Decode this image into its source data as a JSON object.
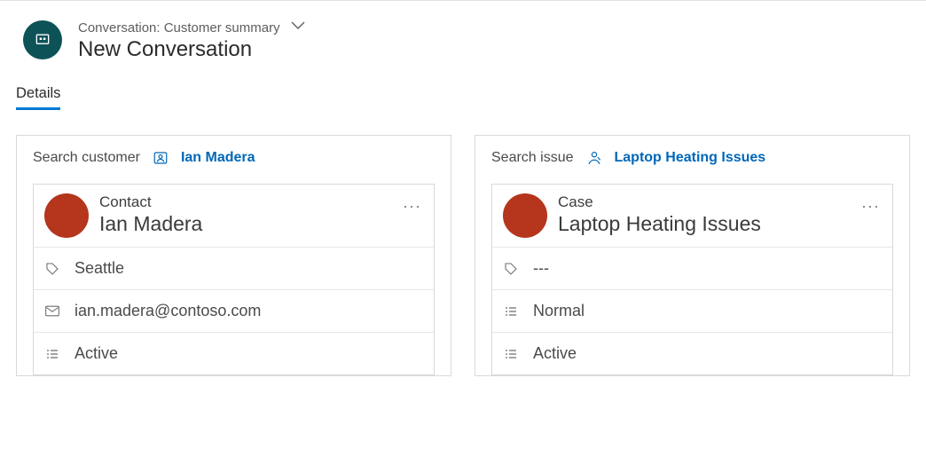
{
  "header": {
    "breadcrumb": "Conversation: Customer summary",
    "title": "New Conversation"
  },
  "tabs": {
    "details": "Details"
  },
  "customerPanel": {
    "searchLabel": "Search customer",
    "linkText": "Ian Madera",
    "card": {
      "type": "Contact",
      "name": "Ian Madera",
      "location": "Seattle",
      "email": "ian.madera@contoso.com",
      "status": "Active"
    }
  },
  "issuePanel": {
    "searchLabel": "Search issue",
    "linkText": "Laptop Heating Issues",
    "card": {
      "type": "Case",
      "name": "Laptop Heating Issues",
      "location": "---",
      "priority": "Normal",
      "status": "Active"
    }
  }
}
